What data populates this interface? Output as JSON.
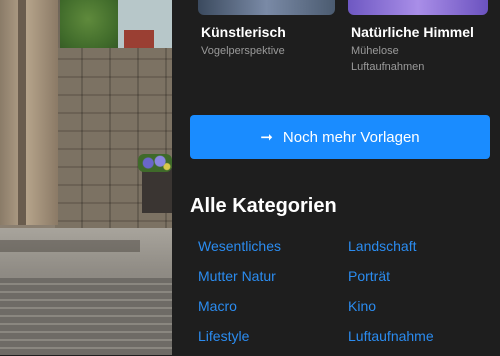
{
  "templates": [
    {
      "title": "Künstlerisch",
      "subtitle": "Vogelperspektive"
    },
    {
      "title": "Natürliche Himmel",
      "subtitle": "Mühelose Luftaufnahmen"
    }
  ],
  "more_button": {
    "icon": "arrow-right-icon",
    "label": "Noch mehr Vorlagen",
    "color": "#1a8cff"
  },
  "categories_section": {
    "title": "Alle Kategorien",
    "items": [
      "Wesentliches",
      "Landschaft",
      "Mutter Natur",
      "Porträt",
      "Macro",
      "Kino",
      "Lifestyle",
      "Luftaufnahme"
    ]
  },
  "colors": {
    "panel_bg": "#1e1e1e",
    "link": "#2b8cf0"
  }
}
